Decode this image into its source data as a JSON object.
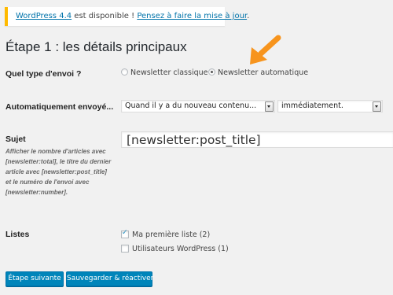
{
  "notice": {
    "link_wp": "WordPress 4.4",
    "text_mid": " est disponible ! ",
    "link_update": "Pensez à faire la mise à jour",
    "text_end": "."
  },
  "page_title": "Étape 1 : les détails principaux",
  "send_type": {
    "label": "Quel type d'envoi ?",
    "options": [
      {
        "label": "Newsletter classique",
        "selected": false
      },
      {
        "label": "Newsletter automatique",
        "selected": true
      }
    ]
  },
  "auto_send": {
    "label": "Automatiquement envoyé...",
    "trigger_value": "Quand il y a du nouveau contenu...",
    "timing_value": "immédiatement."
  },
  "subject": {
    "label": "Sujet",
    "help": "Afficher le nombre d'articles avec [newsletter:total], le titre du dernier article avec [newsletter:post_title] et le numéro de l'envoi avec [newsletter:number].",
    "value": "[newsletter:post_title]"
  },
  "lists": {
    "label": "Listes",
    "items": [
      {
        "label": "Ma première liste (2)",
        "checked": true
      },
      {
        "label": "Utilisateurs WordPress (1)",
        "checked": false
      }
    ]
  },
  "buttons": {
    "next": "Étape suivante",
    "save": "Sauvegarder & réactiver"
  },
  "colors": {
    "primary_button": "#0085ba",
    "notice_border": "#ffba00",
    "arrow": "#f7941d"
  }
}
